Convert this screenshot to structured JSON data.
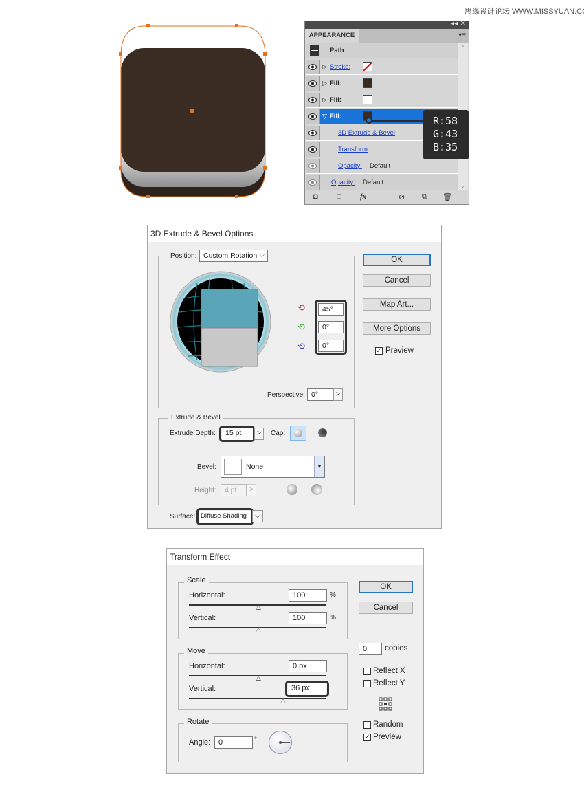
{
  "watermark": "思缘设计论坛 WWW.MISSYUAN.COM",
  "appearance": {
    "tab": "APPEARANCE",
    "path_label": "Path",
    "rows": [
      {
        "kind": "stroke",
        "label": "Stroke:"
      },
      {
        "kind": "fill",
        "label": "Fill:"
      },
      {
        "kind": "fill",
        "label": "Fill:"
      },
      {
        "kind": "fill",
        "label": "Fill:"
      }
    ],
    "effect_extrude": "3D Extrude & Bevel",
    "effect_transform": "Transform",
    "opacity_inner_label": "Opacity:",
    "opacity_inner_value": "Default",
    "opacity_outer_label": "Opacity:",
    "opacity_outer_value": "Default",
    "fx_label": "fx",
    "tooltip": {
      "r": "R:58",
      "g": "G:43",
      "b": "B:35"
    },
    "colors": {
      "fill_dark": "#3a2b23",
      "fill_white": "#ffffff",
      "selection": "#1a73d9",
      "path_orange": "#e8701a"
    }
  },
  "extrude_dialog": {
    "title": "3D Extrude & Bevel Options",
    "position_label": "Position:",
    "position_value": "Custom Rotation",
    "rot_x": "45°",
    "rot_y": "0°",
    "rot_z": "0°",
    "perspective_label": "Perspective:",
    "perspective_value": "0°",
    "extrude_group": "Extrude & Bevel",
    "extrude_depth_label": "Extrude Depth:",
    "extrude_depth_value": "15 pt",
    "cap_label": "Cap:",
    "bevel_label": "Bevel:",
    "bevel_value": "None",
    "height_label": "Height:",
    "height_value": "4 pt",
    "surface_label": "Surface:",
    "surface_value": "Diffuse Shading",
    "ok": "OK",
    "cancel": "Cancel",
    "map_art": "Map Art...",
    "more_options": "More Options",
    "preview": "Preview"
  },
  "transform_dialog": {
    "title": "Transform Effect",
    "scale_group": "Scale",
    "scale_h_label": "Horizontal:",
    "scale_h_value": "100",
    "scale_v_label": "Vertical:",
    "scale_v_value": "100",
    "percent": "%",
    "move_group": "Move",
    "move_h_label": "Horizontal:",
    "move_h_value": "0 px",
    "move_v_label": "Vertical:",
    "move_v_value": "36 px",
    "rotate_group": "Rotate",
    "angle_label": "Angle:",
    "angle_value": "0",
    "degree": "°",
    "ok": "OK",
    "cancel": "Cancel",
    "copies_value": "0",
    "copies_label": "copies",
    "reflect_x": "Reflect X",
    "reflect_y": "Reflect Y",
    "random": "Random",
    "preview": "Preview"
  }
}
